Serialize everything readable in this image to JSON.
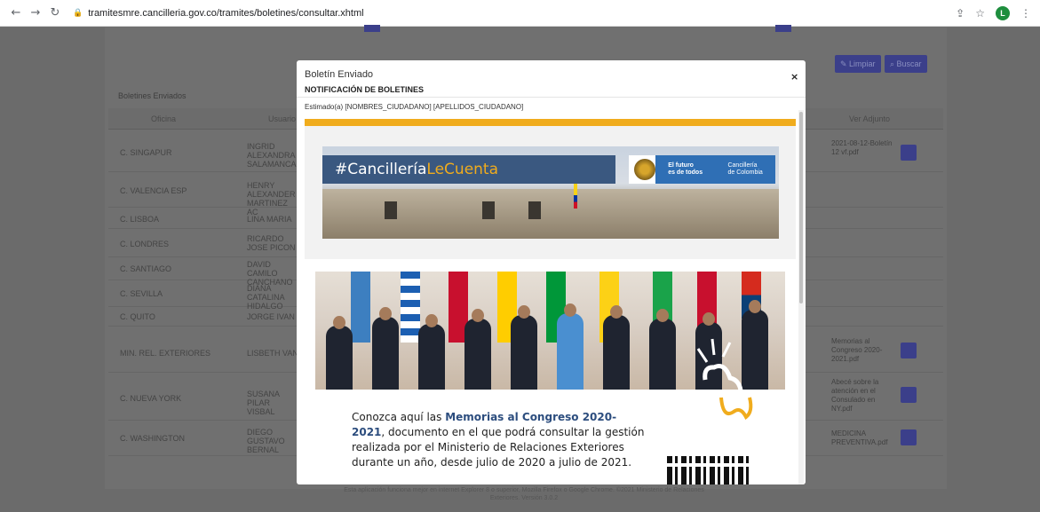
{
  "browser": {
    "url": "tramitesmre.cancilleria.gov.co/tramites/boletines/consultar.xhtml",
    "profile_initial": "L",
    "icons": [
      "back-icon",
      "forward-icon",
      "reload-icon",
      "lock-icon",
      "share-icon",
      "star-icon",
      "menu-icon"
    ]
  },
  "page": {
    "buttons": {
      "limpiar": "Limpiar",
      "buscar": "Buscar"
    },
    "section_title": "Boletines Enviados",
    "columns": [
      "Oficina",
      "Usuario",
      "Ver Adjunto"
    ],
    "rows": [
      {
        "oficina": "C. SINGAPUR",
        "usuario": "INGRID ALEXANDRA SALAMANCA",
        "adjunto": "2021-08-12-Boletín 12 vf.pdf"
      },
      {
        "oficina": "C. VALENCIA ESP",
        "usuario": "HENRY ALEXANDER MARTINEZ AC",
        "adjunto": ""
      },
      {
        "oficina": "C. LISBOA",
        "usuario": "LINA MARIA",
        "adjunto": ""
      },
      {
        "oficina": "C. LONDRES",
        "usuario": "RICARDO JOSE PICON",
        "adjunto": ""
      },
      {
        "oficina": "C. SANTIAGO",
        "usuario": "DAVID CAMILO CANCHANO",
        "adjunto": ""
      },
      {
        "oficina": "C. SEVILLA",
        "usuario": "DIANA CATALINA HIDALGO",
        "adjunto": ""
      },
      {
        "oficina": "C. QUITO",
        "usuario": "JORGE IVAN",
        "adjunto": ""
      },
      {
        "oficina": "MIN. REL. EXTERIORES",
        "usuario": "LISBETH VAN",
        "adjunto": "Memorias al Congreso 2020-2021.pdf"
      },
      {
        "oficina": "C. NUEVA YORK",
        "usuario": "SUSANA PILAR VISBAL",
        "adjunto": "Abecé sobre la atención en el Consulado en NY.pdf"
      },
      {
        "oficina": "C. WASHINGTON",
        "usuario": "DIEGO GUSTAVO BERNAL",
        "adjunto": "MEDICINA PREVENTIVA.pdf"
      }
    ],
    "footer": "Esta aplicación funciona mejor en internet Explorer 8 o superior, Mozilla Firefox o Google Chrome. ©2021 Ministerio de Relaciones Exteriores. Versión 3.0.2"
  },
  "modal": {
    "title": "Boletín Enviado",
    "close_label": "×",
    "subtitle": "NOTIFICACIÓN DE BOLETINES",
    "greeting": "Estimado(a) [NOMBRES_CIUDADANO] [APELLIDOS_CIUDADANO]",
    "banner": {
      "hashtag_prefix": "#Cancillería",
      "hashtag_suffix": "LeCuenta",
      "gov_line1": "El futuro",
      "gov_line2": "es de todos",
      "cancilleria_line1": "Cancillería",
      "cancilleria_line2": "de Colombia"
    },
    "body": {
      "prefix": "Conozca aquí las ",
      "highlight": "Memorias al Congreso 2020-2021",
      "suffix": ", documento en el que podrá consultar la gestión realizada por el Ministerio de Relaciones Exteriores durante un año, desde julio de 2020 a julio de 2021."
    },
    "accent_color": "#f0ac1d",
    "brand_blue": "#2c4d7e"
  }
}
